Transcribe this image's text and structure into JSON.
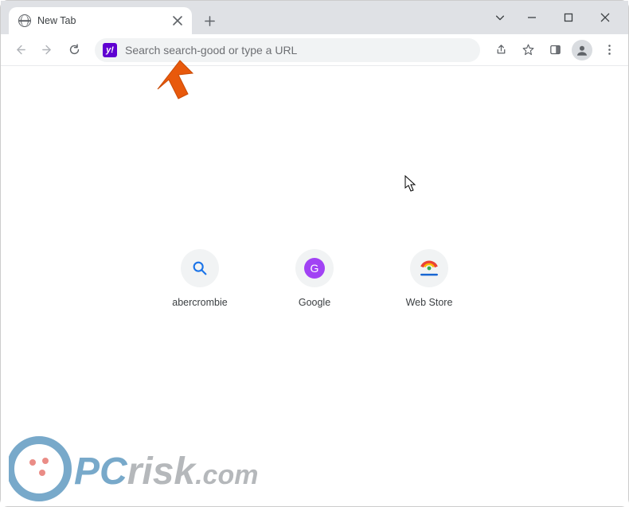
{
  "tab": {
    "title": "New Tab"
  },
  "omnibox": {
    "badge_letter": "y!",
    "placeholder": "Search search-good or type a URL"
  },
  "shortcuts": [
    {
      "label": "abercrombie",
      "icon": "search"
    },
    {
      "label": "Google",
      "icon": "g-letter",
      "letter": "G"
    },
    {
      "label": "Web Store",
      "icon": "webstore"
    }
  ],
  "watermark_text": "PCrisk.com"
}
